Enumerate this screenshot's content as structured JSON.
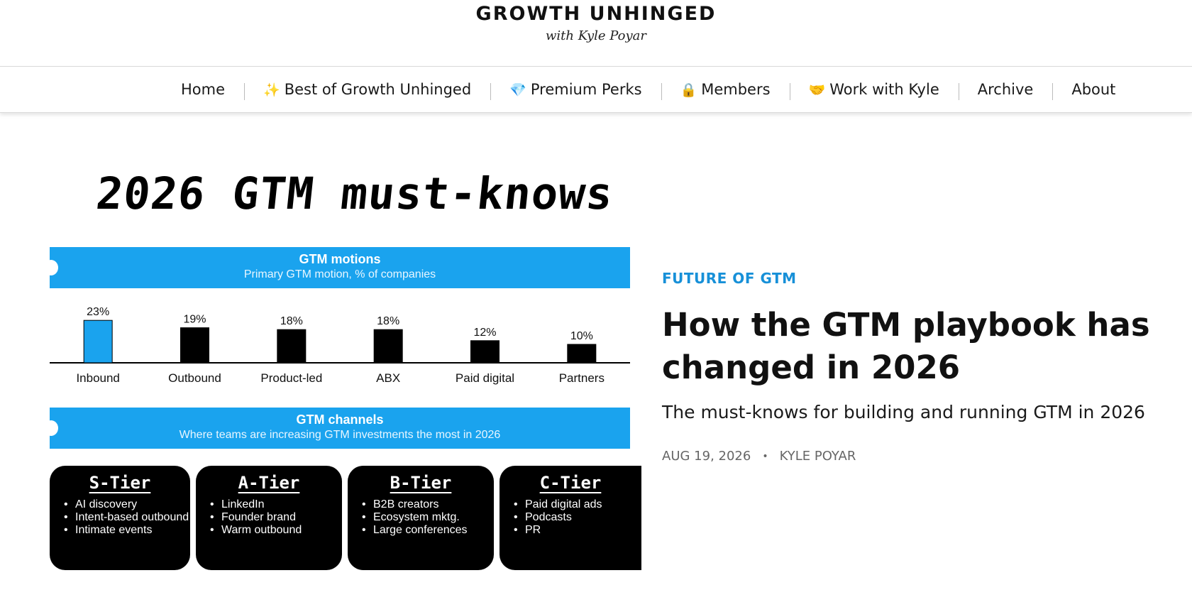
{
  "header": {
    "title": "GROWTH UNHINGED",
    "subtitle": "with Kyle Poyar"
  },
  "nav": {
    "items": [
      {
        "icon": "",
        "label": "Home"
      },
      {
        "icon": "✨",
        "label": "Best of Growth Unhinged"
      },
      {
        "icon": "💎",
        "label": "Premium Perks"
      },
      {
        "icon": "🔒",
        "label": "Members"
      },
      {
        "icon": "🤝",
        "label": "Work with Kyle"
      },
      {
        "icon": "",
        "label": "Archive"
      },
      {
        "icon": "",
        "label": "About"
      }
    ]
  },
  "hero": {
    "heading": "2026 GTM must-knows",
    "motions_band": {
      "title": "GTM motions",
      "subtitle": "Primary GTM motion, % of companies"
    },
    "channels_band": {
      "title": "GTM channels",
      "subtitle": "Where teams are increasing GTM investments the most in 2026"
    },
    "tiers": [
      {
        "title": "S-Tier",
        "items": [
          "AI discovery",
          "Intent-based outbound",
          "Intimate events"
        ]
      },
      {
        "title": "A-Tier",
        "items": [
          "LinkedIn",
          "Founder brand",
          "Warm outbound"
        ]
      },
      {
        "title": "B-Tier",
        "items": [
          "B2B creators",
          "Ecosystem mktg.",
          "Large conferences"
        ]
      },
      {
        "title": "C-Tier",
        "items": [
          "Paid digital ads",
          "Podcasts",
          "PR"
        ]
      }
    ]
  },
  "chart_data": {
    "type": "bar",
    "title": "GTM motions",
    "subtitle": "Primary GTM motion, % of companies",
    "categories": [
      "Inbound",
      "Outbound",
      "Product-led",
      "ABX",
      "Paid digital",
      "Partners"
    ],
    "values": [
      23,
      19,
      18,
      18,
      12,
      10
    ],
    "value_labels": [
      "23%",
      "19%",
      "18%",
      "18%",
      "12%",
      "10%"
    ],
    "bar_colors": [
      "#1aa3ee",
      "#000000",
      "#000000",
      "#000000",
      "#000000",
      "#000000"
    ],
    "ylim": [
      0,
      25
    ],
    "grid": false,
    "legend": "none"
  },
  "article": {
    "category": "FUTURE OF GTM",
    "title": "How the GTM playbook has changed in 2026",
    "subtitle": "The must-knows for building and running GTM in 2026",
    "date": "AUG 19, 2026",
    "separator": "•",
    "author": "KYLE POYAR"
  },
  "colors": {
    "accent_blue": "#1aa3ee",
    "category_blue": "#1790d8",
    "text": "#111111",
    "meta_gray": "#666666"
  }
}
